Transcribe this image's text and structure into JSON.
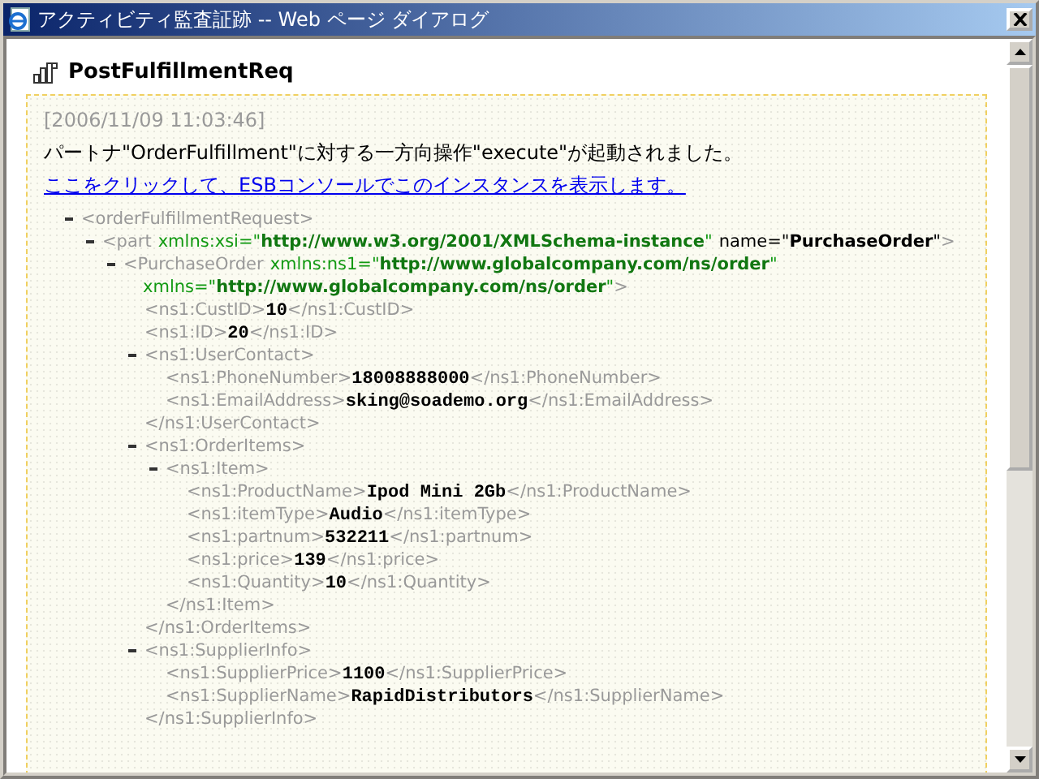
{
  "window": {
    "title": "アクティビティ監査証跡 -- Web ページ ダイアログ"
  },
  "heading": "PostFulfillmentReq",
  "event": {
    "timestamp": "[2006/11/09 11:03:46]",
    "message": "パートナ\"OrderFulfillment\"に対する一方向操作\"execute\"が起動されました。",
    "link": "ここをクリックして、ESBコンソールでこのインスタンスを表示します。"
  },
  "xml_tree": [
    {
      "tag": "<orderFulfillmentRequest",
      "tag_end": ">",
      "expanded": true,
      "children": [
        {
          "tag": "<part",
          "attributes": [
            {
              "kind": "namespace",
              "text": "xmlns:xsi=\"**http://www.w3.org/2001/XMLSchema-instance**\""
            },
            {
              "kind": "plain",
              "text": "name=\"**PurchaseOrder**\""
            }
          ],
          "tag_end": ">",
          "expanded": true,
          "children": [
            {
              "tag": "<PurchaseOrder",
              "attributes": [
                {
                  "kind": "namespace",
                  "text": "xmlns:ns1=\"**http://www.globalcompany.com/ns/order**\""
                },
                {
                  "kind": "namespace",
                  "text": "xmlns=\"**http://www.globalcompany.com/ns/order**\""
                }
              ],
              "tag_end": ">",
              "expanded": true,
              "children": [
                {
                  "tag": "<ns1:CustID",
                  "tag_end": ">",
                  "value": "10",
                  "close": "</ns1:CustID>"
                },
                {
                  "tag": "<ns1:ID",
                  "tag_end": ">",
                  "value": "20",
                  "close": "</ns1:ID>"
                },
                {
                  "tag": "<ns1:UserContact",
                  "tag_end": ">",
                  "expanded": true,
                  "close": "</ns1:UserContact>",
                  "children": [
                    {
                      "tag": "<ns1:PhoneNumber",
                      "tag_end": ">",
                      "value": "18008888000",
                      "close": "</ns1:PhoneNumber>"
                    },
                    {
                      "tag": "<ns1:EmailAddress",
                      "tag_end": ">",
                      "value": "sking@soademo.org",
                      "close": "</ns1:EmailAddress>"
                    }
                  ]
                },
                {
                  "tag": "<ns1:OrderItems",
                  "tag_end": ">",
                  "expanded": true,
                  "close": "</ns1:OrderItems>",
                  "children": [
                    {
                      "tag": "<ns1:Item",
                      "tag_end": ">",
                      "expanded": true,
                      "close": "</ns1:Item>",
                      "children": [
                        {
                          "tag": "<ns1:ProductName",
                          "tag_end": ">",
                          "value": "Ipod Mini 2Gb",
                          "close": "</ns1:ProductName>"
                        },
                        {
                          "tag": "<ns1:itemType",
                          "tag_end": ">",
                          "value": "Audio",
                          "close": "</ns1:itemType>"
                        },
                        {
                          "tag": "<ns1:partnum",
                          "tag_end": ">",
                          "value": "532211",
                          "close": "</ns1:partnum>"
                        },
                        {
                          "tag": "<ns1:price",
                          "tag_end": ">",
                          "value": "139",
                          "close": "</ns1:price>"
                        },
                        {
                          "tag": "<ns1:Quantity",
                          "tag_end": ">",
                          "value": "10",
                          "close": "</ns1:Quantity>"
                        }
                      ]
                    }
                  ]
                },
                {
                  "tag": "<ns1:SupplierInfo",
                  "tag_end": ">",
                  "expanded": true,
                  "close": "</ns1:SupplierInfo>",
                  "children": [
                    {
                      "tag": "<ns1:SupplierPrice",
                      "tag_end": ">",
                      "value": "1100",
                      "close": "</ns1:SupplierPrice>"
                    },
                    {
                      "tag": "<ns1:SupplierName",
                      "tag_end": ">",
                      "value": "RapidDistributors",
                      "close": "</ns1:SupplierName>"
                    }
                  ]
                }
              ]
            }
          ]
        }
      ]
    }
  ]
}
